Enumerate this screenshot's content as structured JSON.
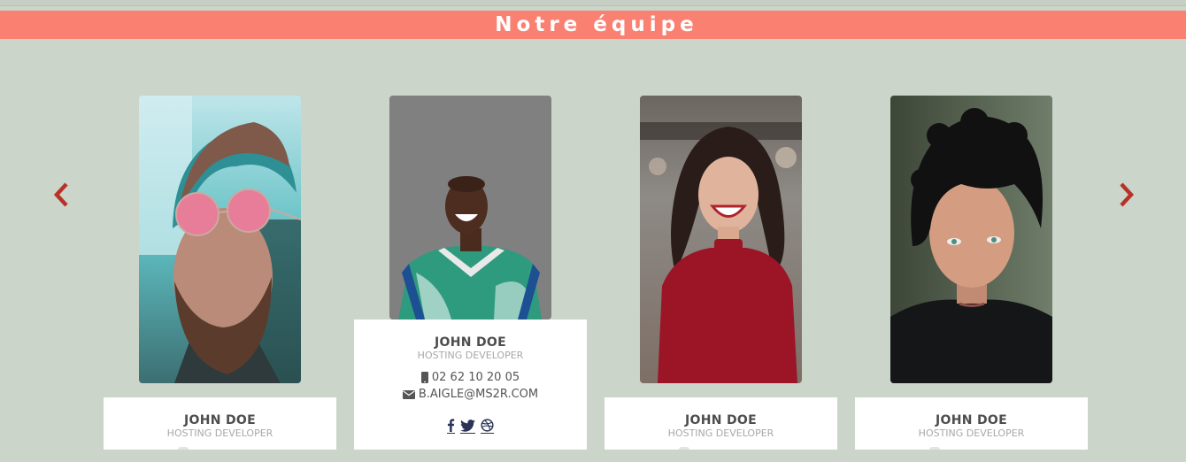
{
  "section": {
    "title": "Notre équipe"
  },
  "carousel": {
    "prev_icon": "chevron-left-icon",
    "next_icon": "chevron-right-icon",
    "arrow_color": "#b83227"
  },
  "colors": {
    "banner": "#fa8072",
    "background": "#cbd5ca"
  },
  "members": [
    {
      "name": "JOHN DOE",
      "role": "HOSTING DEVELOPER",
      "photo": "man-with-pink-sunglasses-photo"
    },
    {
      "name": "JOHN DOE",
      "role": "HOSTING DEVELOPER",
      "photo": "smiling-man-in-green-jersey-photo",
      "phone": "02 62 10 20 05",
      "email": "B.AIGLE@MS2R.COM",
      "socials": [
        "facebook-icon",
        "twitter-icon",
        "dribbble-icon"
      ]
    },
    {
      "name": "JOHN DOE",
      "role": "HOSTING DEVELOPER",
      "photo": "laughing-woman-in-red-top-photo"
    },
    {
      "name": "JOHN DOE",
      "role": "HOSTING DEVELOPER",
      "photo": "young-man-dark-curly-hair-photo"
    }
  ]
}
